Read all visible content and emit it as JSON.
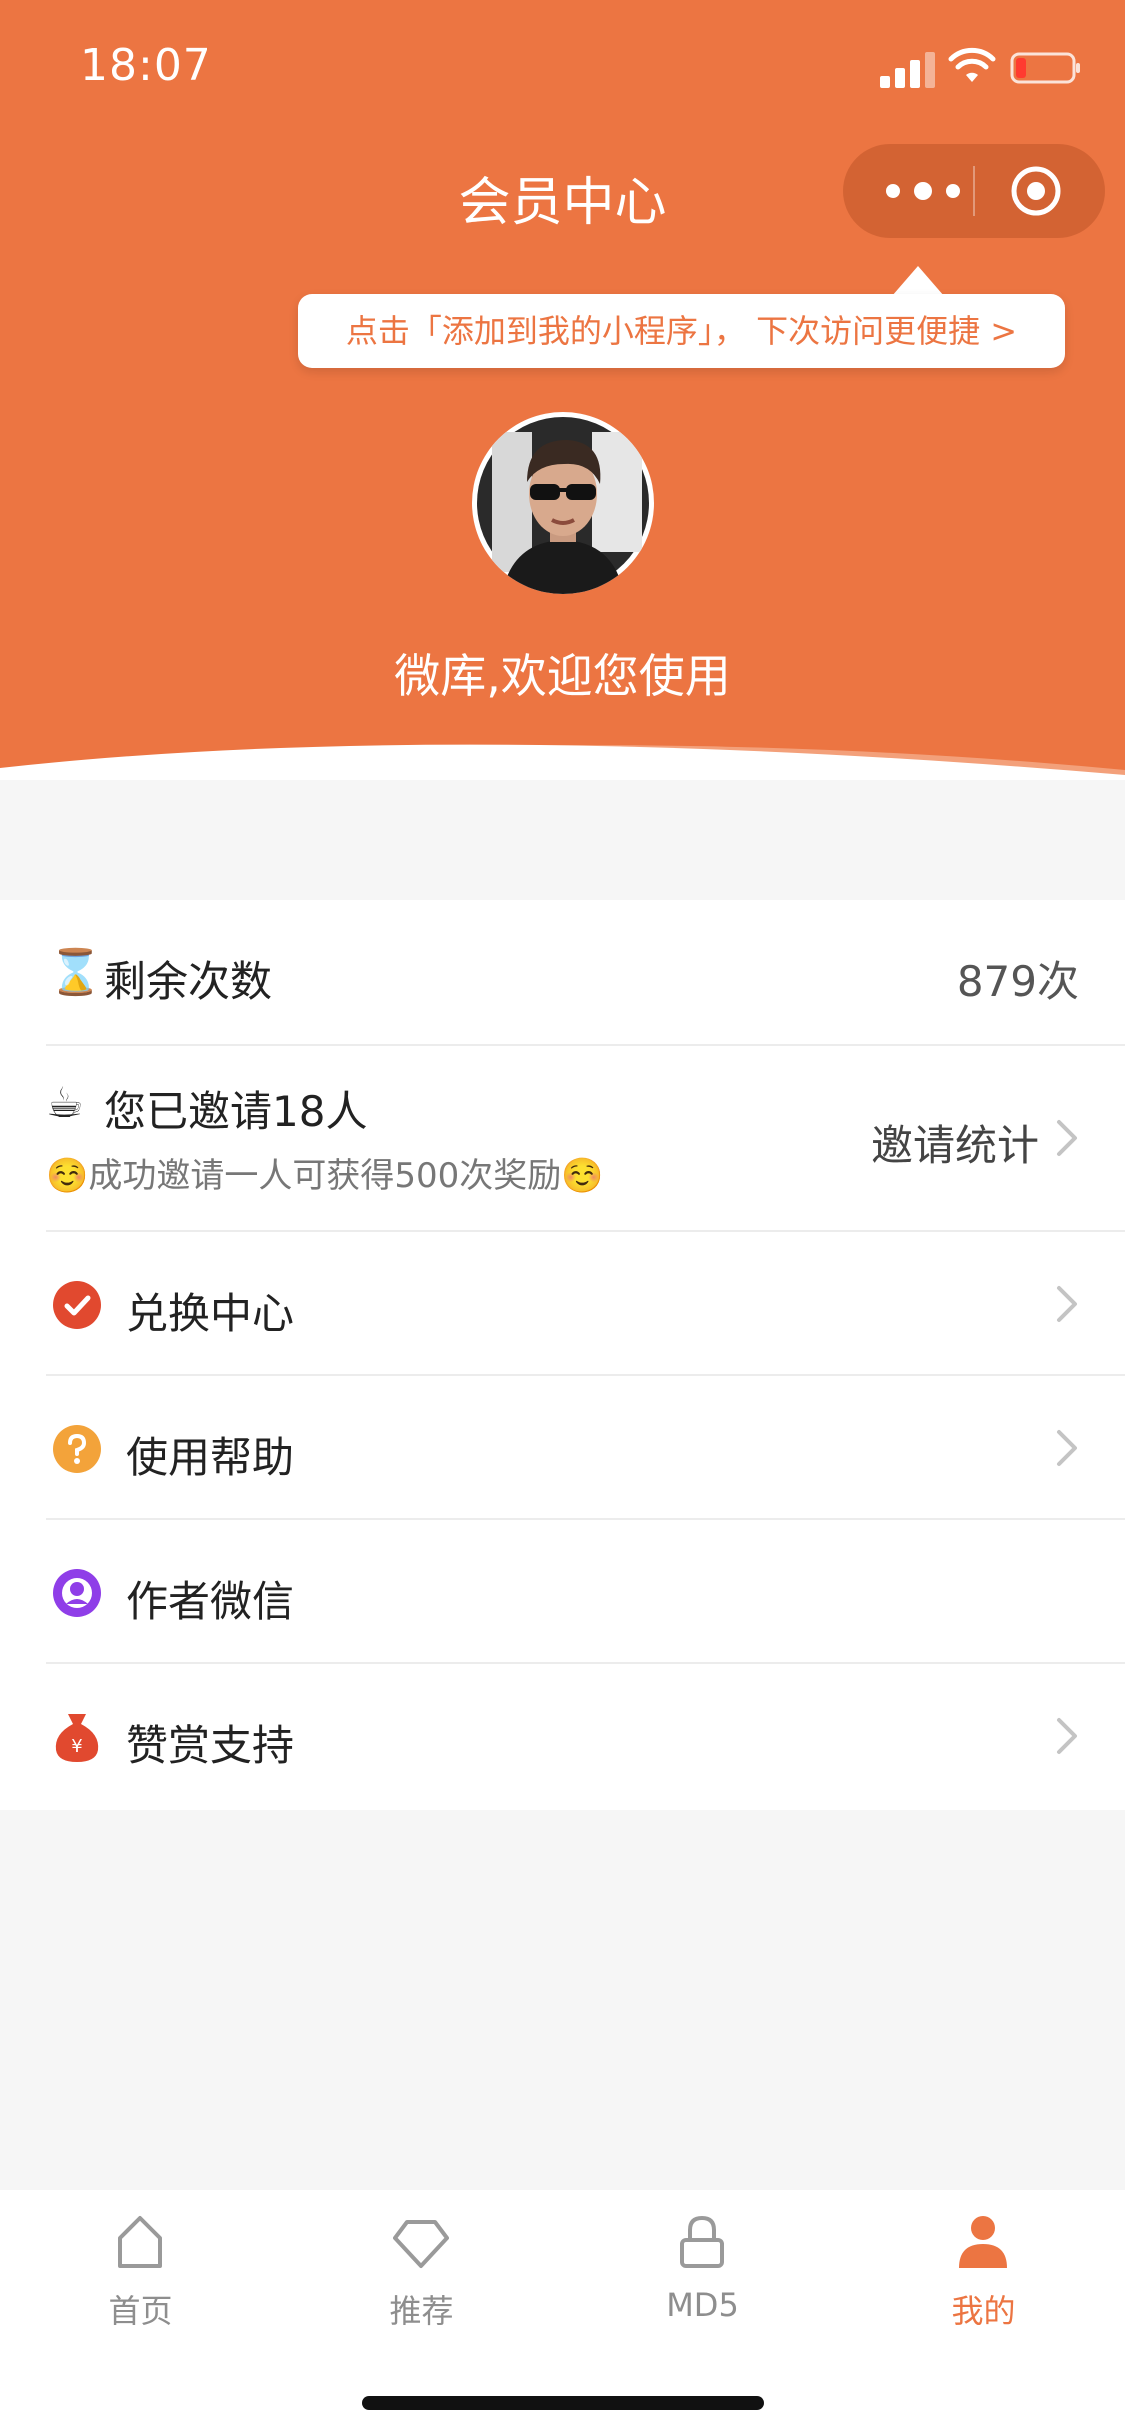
{
  "status_bar": {
    "time": "18:07"
  },
  "header": {
    "title": "会员中心",
    "tooltip": "点击「添加到我的小程序」， 下次访问更便捷 >",
    "welcome": "微库,欢迎您使用"
  },
  "menu": {
    "remaining": {
      "icon": "⌛",
      "label": "剩余次数",
      "value": "879次"
    },
    "invite": {
      "icon": "☕",
      "label": "您已邀请18人",
      "sub": "☺️成功邀请一人可获得500次奖励☺️",
      "action": "邀请统计"
    },
    "items": [
      {
        "label": "兑换中心",
        "icon": "check-circle-icon"
      },
      {
        "label": "使用帮助",
        "icon": "question-circle-icon"
      },
      {
        "label": "作者微信",
        "icon": "user-circle-icon"
      },
      {
        "label": "赞赏支持",
        "icon": "money-bag-icon"
      }
    ]
  },
  "tabbar": {
    "tabs": [
      {
        "label": "首页",
        "icon": "home-icon"
      },
      {
        "label": "推荐",
        "icon": "diamond-icon"
      },
      {
        "label": "MD5",
        "icon": "lock-icon"
      },
      {
        "label": "我的",
        "icon": "person-icon"
      }
    ],
    "active": 3
  },
  "colors": {
    "brand": "#ec7542",
    "text": "#222222",
    "muted": "#8e8e8e"
  }
}
